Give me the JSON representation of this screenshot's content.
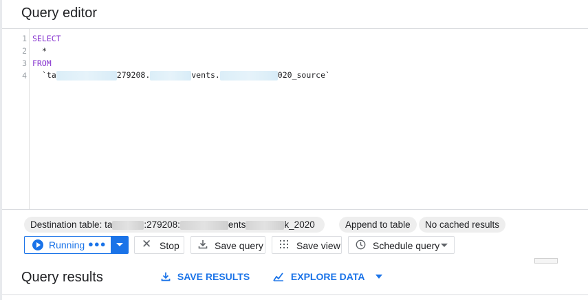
{
  "editor": {
    "title": "Query editor",
    "line_numbers": [
      "1",
      "2",
      "3",
      "4"
    ],
    "code": {
      "select_kw": "SELECT",
      "star": "*",
      "from_kw": "FROM",
      "table_open": "`ta",
      "table_mid1": "279208.",
      "table_mid2": "vents.",
      "table_end": "020_source`"
    }
  },
  "chips": {
    "destination_prefix": "Destination table: ta",
    "destination_mid1": ":279208:",
    "destination_mid2": "ents",
    "destination_suffix": "k_2020",
    "append": "Append to table",
    "cache": "No cached results"
  },
  "toolbar": {
    "running_label": "Running",
    "running_dots": "●●●",
    "stop_label": "Stop",
    "save_query_label": "Save query",
    "save_view_label": "Save view",
    "schedule_label": "Schedule query"
  },
  "results": {
    "title": "Query results",
    "save_results": "SAVE RESULTS",
    "explore_data": "EXPLORE DATA"
  },
  "colors": {
    "accent": "#1a73e8",
    "keyword": "#8430ce"
  }
}
